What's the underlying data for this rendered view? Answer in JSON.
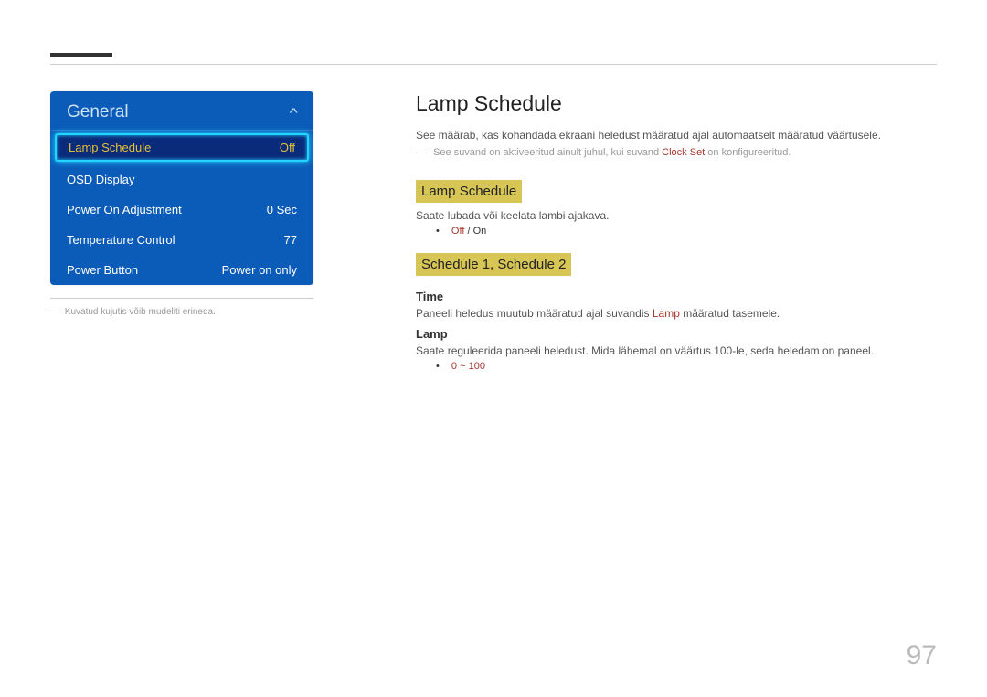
{
  "panel": {
    "title": "General",
    "items": [
      {
        "label": "Lamp Schedule",
        "value": "Off",
        "selected": true
      },
      {
        "label": "OSD Display",
        "value": "",
        "selected": false
      },
      {
        "label": "Power On Adjustment",
        "value": "0 Sec",
        "selected": false
      },
      {
        "label": "Temperature Control",
        "value": "77",
        "selected": false
      },
      {
        "label": "Power Button",
        "value": "Power on only",
        "selected": false
      }
    ],
    "note": "Kuvatud kujutis võib mudeliti erineda."
  },
  "content": {
    "h1": "Lamp Schedule",
    "desc": "See määrab, kas kohandada ekraani heledust määratud ajal automaatselt määratud väärtusele.",
    "note_before": "See suvand on aktiveeritud ainult juhul, kui suvand ",
    "note_accent": "Clock Set",
    "note_after": " on konfigureeritud.",
    "h2a": "Lamp Schedule",
    "h2a_desc": "Saate lubada või keelata lambi ajakava.",
    "h2a_bullet_off": "Off",
    "h2a_bullet_sep": " / On",
    "h2b": "Schedule 1, Schedule 2",
    "h3_time": "Time",
    "time_desc_before": "Paneeli heledus muutub määratud ajal suvandis ",
    "time_desc_accent": "Lamp",
    "time_desc_after": " määratud tasemele.",
    "h3_lamp": "Lamp",
    "lamp_desc": "Saate reguleerida paneeli heledust. Mida lähemal on väärtus 100-le, seda heledam on paneel.",
    "lamp_bullet_range": "0",
    "lamp_bullet_range_after": " ~ ",
    "lamp_bullet_range_end": "100"
  },
  "page": "97"
}
